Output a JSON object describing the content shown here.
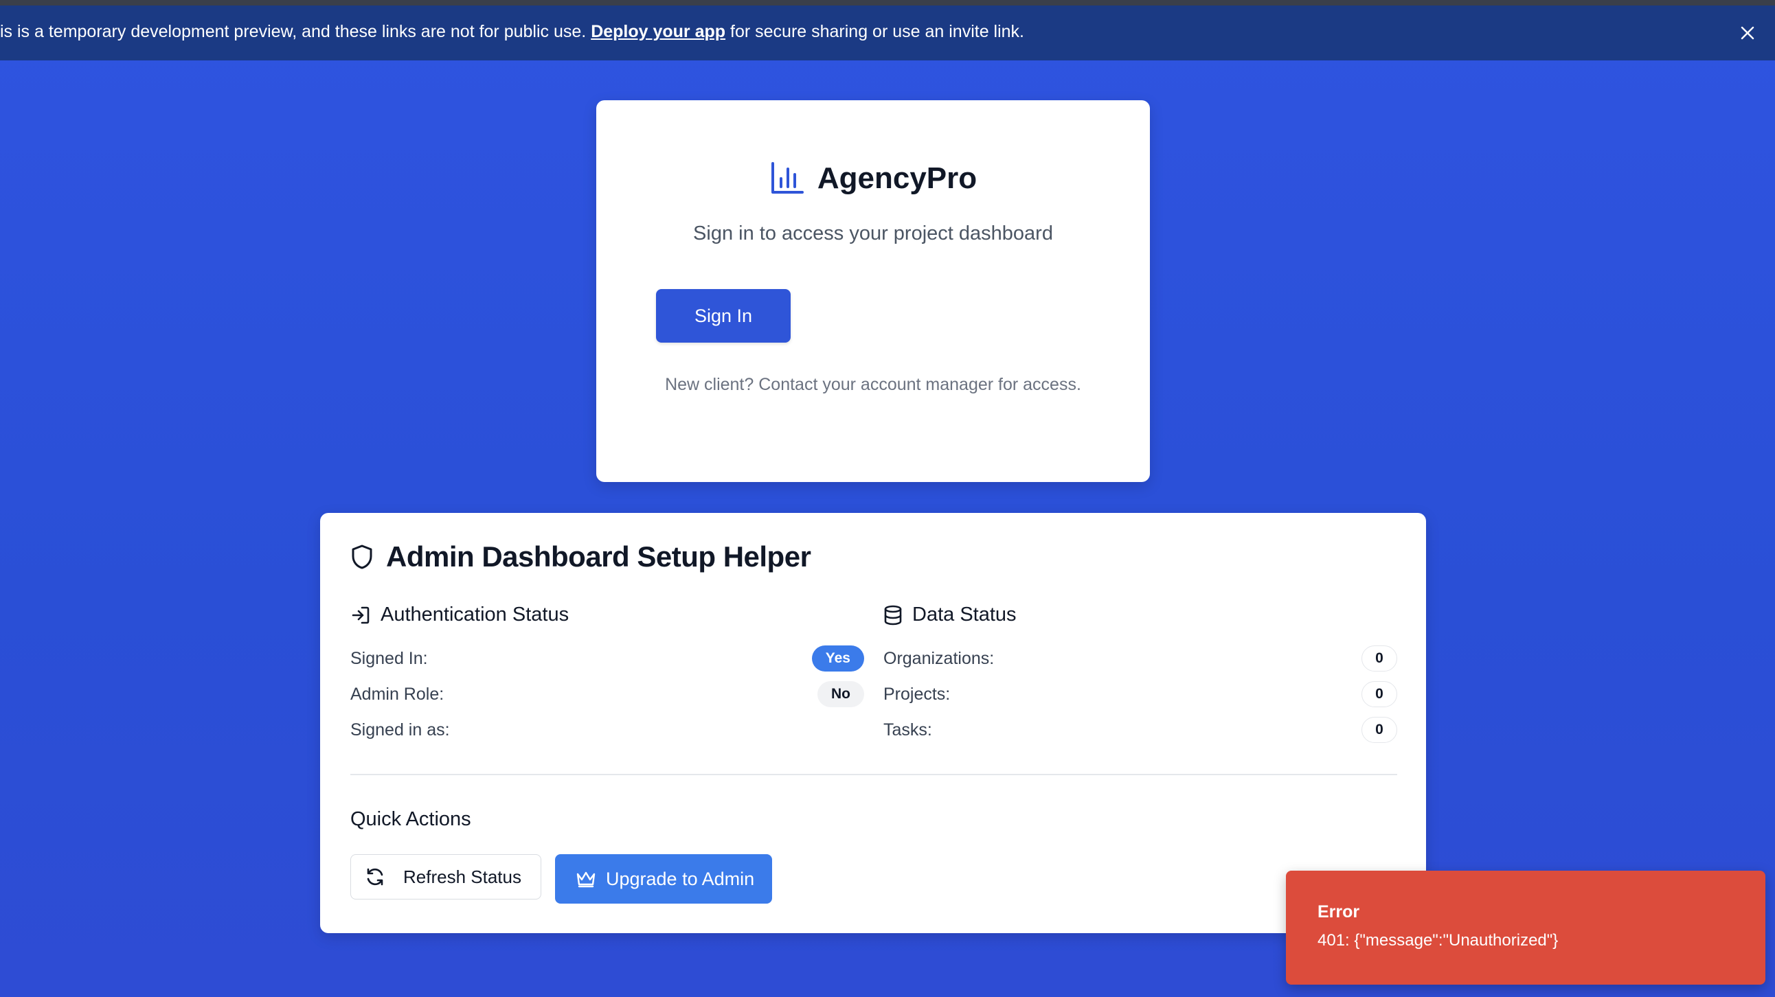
{
  "banner": {
    "text_before": "is is a temporary development preview, and these links are not for public use.",
    "link_text": "Deploy your app",
    "text_after": "for secure sharing or use an invite link.",
    "close_icon": "close-icon"
  },
  "signin": {
    "brand_icon": "bar-chart-icon",
    "brand_name": "AgencyPro",
    "tagline": "Sign in to access your project dashboard",
    "button_label": "Sign In",
    "new_client_text": "New client? Contact your account manager for access."
  },
  "admin": {
    "title_icon": "shield-icon",
    "title": "Admin Dashboard Setup Helper",
    "auth": {
      "heading_icon": "sign-in-icon",
      "heading": "Authentication Status",
      "rows": [
        {
          "label": "Signed In:",
          "value": "Yes"
        },
        {
          "label": "Admin Role:",
          "value": "No"
        },
        {
          "label": "Signed in as:",
          "value": ""
        }
      ]
    },
    "data": {
      "heading_icon": "database-icon",
      "heading": "Data Status",
      "rows": [
        {
          "label": "Organizations:",
          "value": "0"
        },
        {
          "label": "Projects:",
          "value": "0"
        },
        {
          "label": "Tasks:",
          "value": "0"
        }
      ]
    },
    "quick_actions": {
      "title": "Quick Actions",
      "refresh_icon": "refresh-icon",
      "refresh_label": "Refresh Status",
      "upgrade_icon": "crown-icon",
      "upgrade_label": "Upgrade to Admin"
    }
  },
  "toast": {
    "title": "Error",
    "message": "401: {\"message\":\"Unauthorized\"}"
  },
  "colors": {
    "background": "#2f54e0",
    "banner": "#1b3a84",
    "primary_button": "#2f55d8",
    "accent": "#3b7bea",
    "error": "#dc4c3c"
  }
}
